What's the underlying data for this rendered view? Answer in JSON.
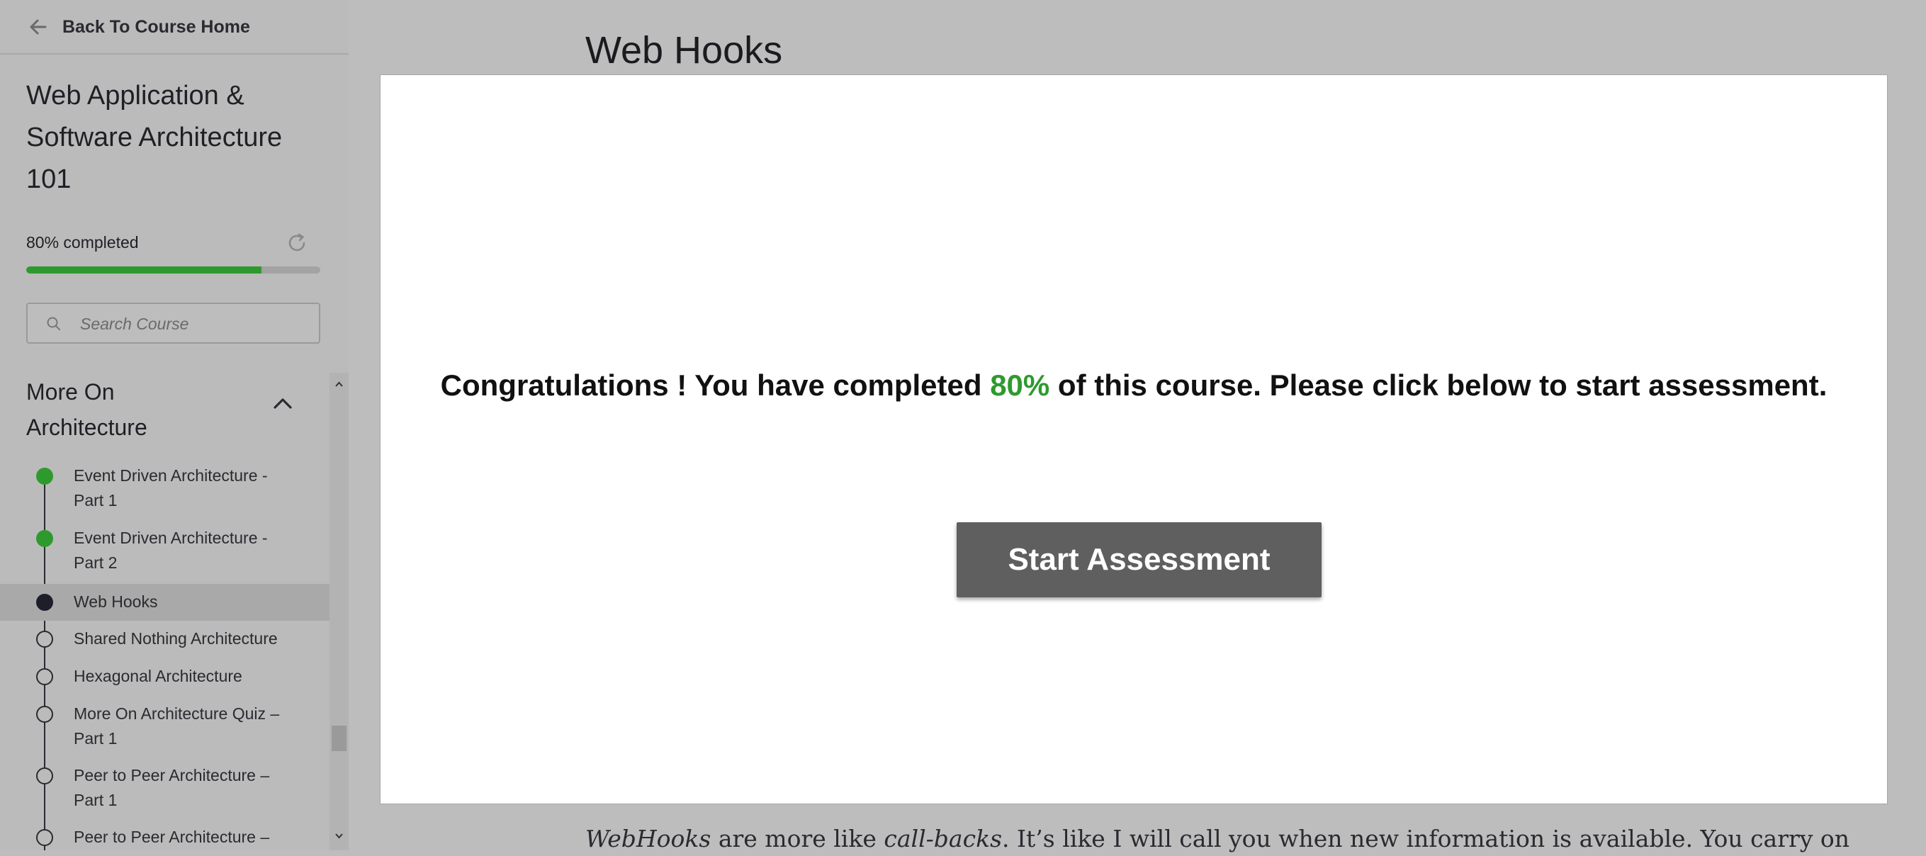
{
  "sidebar": {
    "back_label": "Back To Course Home",
    "course_title": "Web Application & Software Architecture 101",
    "progress_text": "80% completed",
    "progress_percent": 80,
    "search_placeholder": "Search Course",
    "section": {
      "title": "More On Architecture",
      "lessons": [
        {
          "label": "Event Driven Architecture - Part 1",
          "status": "done"
        },
        {
          "label": "Event Driven Architecture - Part 2",
          "status": "done"
        },
        {
          "label": "Web Hooks",
          "status": "current"
        },
        {
          "label": "Shared Nothing Architecture",
          "status": "todo"
        },
        {
          "label": "Hexagonal Architecture",
          "status": "todo"
        },
        {
          "label": "More On Architecture Quiz – Part 1",
          "status": "todo"
        },
        {
          "label": "Peer to Peer Architecture – Part 1",
          "status": "todo"
        },
        {
          "label": "Peer to Peer Architecture –",
          "status": "todo"
        }
      ]
    }
  },
  "main": {
    "page_title": "Web Hooks",
    "congrats_before": "Congratulations ! You have completed ",
    "congrats_percent": "80%",
    "congrats_after": " of this course. Please click below to start assessment.",
    "start_button_label": "Start Assessment",
    "body_text": {
      "em1": "WebHooks",
      "t1": " are more like ",
      "em2": "call-backs",
      "t2": ". It’s like I will call you when new information is available. You carry on"
    }
  },
  "colors": {
    "accent_green": "#2e9a2e",
    "overlay_gray": "#bdbdbd",
    "button_gray": "#5f5f5f"
  }
}
